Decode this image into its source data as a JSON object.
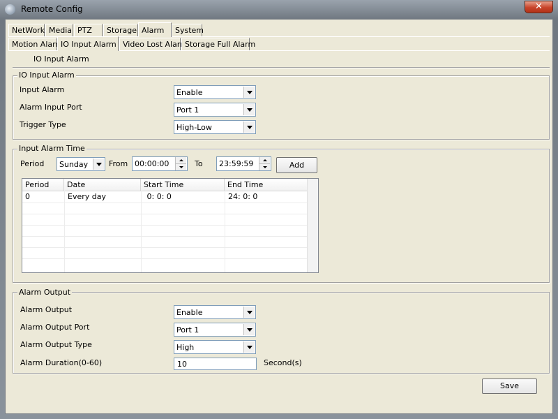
{
  "window": {
    "title": "Remote Config",
    "close_label": "✕"
  },
  "main_tabs": [
    {
      "label": "NetWork"
    },
    {
      "label": "Media"
    },
    {
      "label": "PTZ"
    },
    {
      "label": "Storage"
    },
    {
      "label": "Alarm",
      "active": true
    },
    {
      "label": "System"
    }
  ],
  "sub_tabs": [
    {
      "label": "Motion Alarm"
    },
    {
      "label": "IO Input Alarm",
      "active": true
    },
    {
      "label": "Video Lost Alarm"
    },
    {
      "label": "Storage Full Alarm"
    }
  ],
  "page_title": "IO Input Alarm",
  "io_input": {
    "legend": "IO Input Alarm",
    "input_alarm_label": "Input Alarm",
    "input_alarm_value": "Enable",
    "input_port_label": "Alarm Input Port",
    "input_port_value": "Port 1",
    "trigger_label": "Trigger Type",
    "trigger_value": "High-Low"
  },
  "alarm_time": {
    "legend": "Input Alarm Time",
    "period_label": "Period",
    "period_value": "Sunday",
    "from_label": "From",
    "from_value": "00:00:00",
    "to_label": "To",
    "to_value": "23:59:59",
    "add_label": "Add",
    "columns": [
      "Period",
      "Date",
      "Start Time",
      "End Time"
    ],
    "rows": [
      [
        "0",
        "Every day",
        " 0: 0: 0",
        "24: 0: 0"
      ]
    ]
  },
  "alarm_output": {
    "legend": "Alarm Output",
    "output_label": "Alarm Output",
    "output_value": "Enable",
    "port_label": "Alarm Output Port",
    "port_value": "Port 1",
    "type_label": "Alarm Output Type",
    "type_value": "High",
    "duration_label": "Alarm Duration(0-60)",
    "duration_value": "10",
    "duration_unit": "Second(s)"
  },
  "save_label": "Save",
  "colors": {
    "face": "#ece9d8",
    "close": "#c8442a"
  }
}
